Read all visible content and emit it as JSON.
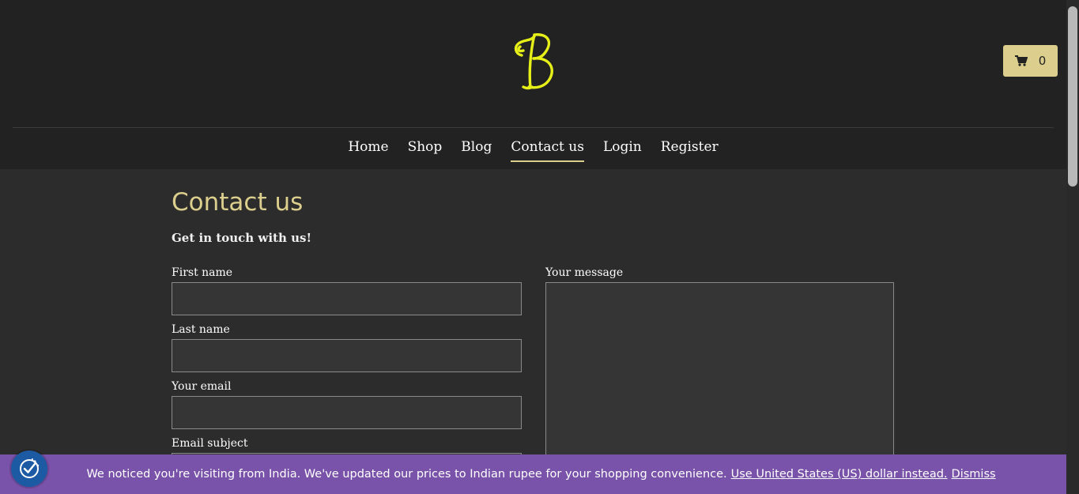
{
  "header": {
    "logo_letter": "B",
    "logo_icon": "script-b-logo",
    "cart_icon": "shopping-cart-icon",
    "cart_count": "0"
  },
  "nav": {
    "items": [
      "Home",
      "Shop",
      "Blog",
      "Contact us",
      "Login",
      "Register"
    ],
    "active": "Contact us"
  },
  "main": {
    "title": "Contact us",
    "subtitle": "Get in touch with us!",
    "fields": {
      "first_name_label": "First name",
      "first_name_value": "",
      "last_name_label": "Last name",
      "last_name_value": "",
      "email_label": "Your email",
      "email_value": "",
      "subject_label": "Email subject",
      "subject_value": "",
      "message_label": "Your message",
      "message_value": ""
    }
  },
  "notice": {
    "text": "We noticed you're visiting from India. We've updated our prices to Indian rupee for your shopping convenience.",
    "currency_link": "Use United States (US) dollar instead.",
    "dismiss_link": "Dismiss"
  },
  "privacy_button_icon": "privacy-settings-icon",
  "colors": {
    "header_bg": "#222222",
    "page_bg": "#2c2c2c",
    "accent": "#dccf8d",
    "logo": "#e6f018",
    "notice_bg": "#7952a9",
    "privacy_button": "#1c5aa4"
  }
}
